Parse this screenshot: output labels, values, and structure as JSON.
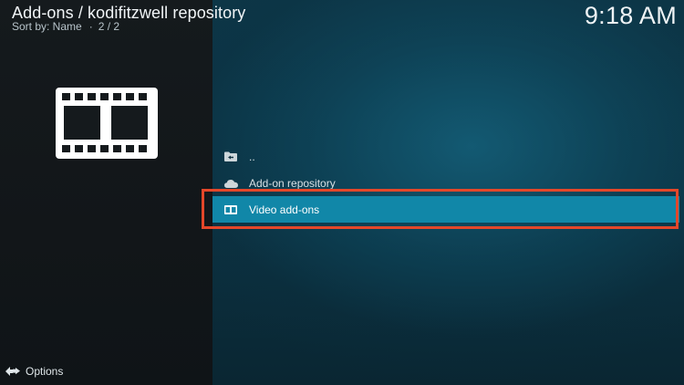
{
  "header": {
    "title": "Add-ons / kodifitzwell repository",
    "sort_label": "Sort by: Name",
    "separator": "·",
    "page_indicator": "2 / 2"
  },
  "clock": "9:18 AM",
  "preview": {
    "icon": "film-strip-icon"
  },
  "list": {
    "items": [
      {
        "label": "..",
        "icon": "folder-back-icon"
      },
      {
        "label": "Add-on repository",
        "icon": "cloud-icon"
      },
      {
        "label": "Video add-ons",
        "icon": "film-small-icon",
        "selected": true
      }
    ]
  },
  "footer": {
    "options_label": "Options",
    "options_icon": "options-arrows-icon"
  },
  "colors": {
    "selected_row": "#1187a8",
    "highlight_border": "#e4472a",
    "left_panel": "#14191c",
    "right_panel": "#0d3647"
  }
}
